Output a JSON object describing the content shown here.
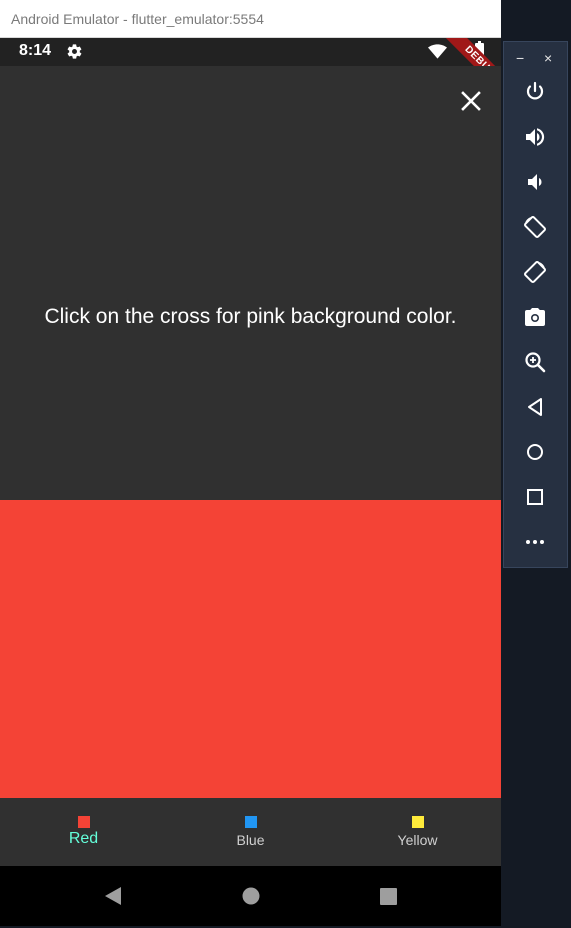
{
  "window": {
    "title": "Android Emulator - flutter_emulator:5554"
  },
  "status_bar": {
    "time": "8:14",
    "banner": "DEBUG"
  },
  "screen": {
    "message": "Click on the cross for pink background color.",
    "panel_color": "#f44336"
  },
  "bottom_nav": {
    "items": [
      {
        "label": "Red",
        "color": "#f44336",
        "selected": true
      },
      {
        "label": "Blue",
        "color": "#2196f3",
        "selected": false
      },
      {
        "label": "Yellow",
        "color": "#ffeb3b",
        "selected": false
      }
    ],
    "active_label_color": "#64ffda",
    "inactive_label_color": "#cfcfcf"
  },
  "sidebar": {
    "top": {
      "minimize": "−",
      "close": "×"
    },
    "buttons": [
      "power-icon",
      "volume-up-icon",
      "volume-down-icon",
      "rotate-left-icon",
      "rotate-right-icon",
      "camera-icon",
      "zoom-icon",
      "back-icon",
      "home-icon",
      "overview-icon",
      "more-icon"
    ]
  }
}
